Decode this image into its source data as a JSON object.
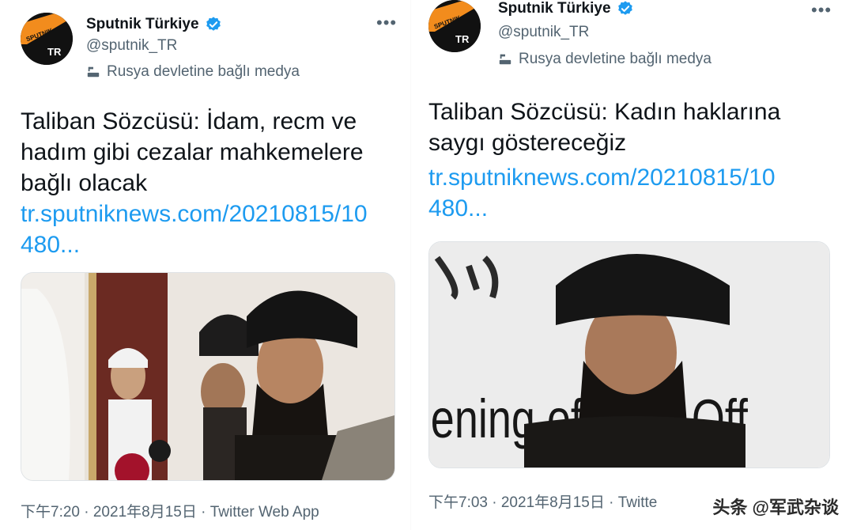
{
  "left_tweet": {
    "account": {
      "name": "Sputnik Türkiye",
      "handle": "@sputnik_TR",
      "label": "Rusya devletine bağlı medya",
      "logo_text": "SPUTNIK",
      "logo_sub": "TR"
    },
    "text_lines": [
      "Taliban Sözcüsü: İdam, recm ve",
      "hadım gibi cezalar mahkemelere",
      "bağlı olacak"
    ],
    "link_lines": [
      "tr.sputniknews.com/20210815/10",
      "480..."
    ],
    "meta": "下午7:20 · 2021年8月15日 · Twitter Web App",
    "more_icon": "more-horizontal-icon"
  },
  "right_tweet": {
    "account": {
      "name": "Sputnik Türkiye",
      "handle": "@sputnik_TR",
      "label": "Rusya devletine bağlı medya",
      "logo_text": "SPUTNIK",
      "logo_sub": "TR"
    },
    "text_lines": [
      "Taliban Sözcüsü: Kadın haklarına",
      "saygı göstereceğiz"
    ],
    "link_lines": [
      "tr.sputniknews.com/20210815/10",
      "480..."
    ],
    "meta": "下午7:03 · 2021年8月15日 · Twitte",
    "photo_backdrop_text": "ening of   itical Off",
    "more_icon": "more-horizontal-icon"
  },
  "watermark": "头条 @军武杂谈",
  "colors": {
    "link": "#1d9bf0",
    "verified": "#1d9bf0",
    "secondary": "#536471",
    "logo_orange": "#f28c1d"
  }
}
